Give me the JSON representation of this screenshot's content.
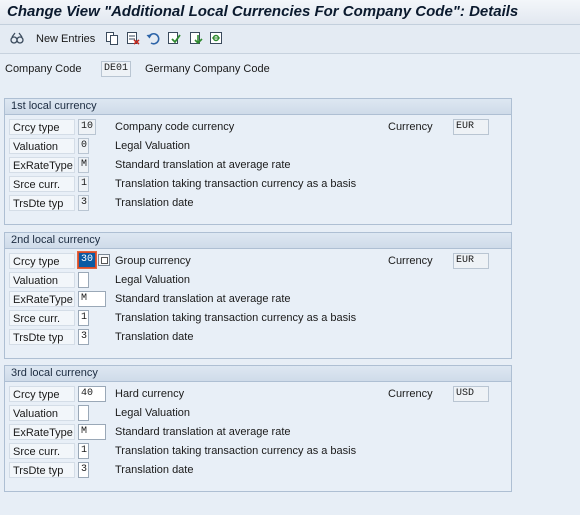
{
  "title": "Change View \"Additional Local Currencies For Company Code\": Details",
  "toolbar": {
    "new_entries_label": "New Entries",
    "icons": [
      "glasses-icon",
      "copy-icon",
      "delete-icon",
      "undo-icon",
      "select-all-icon",
      "deselect-all-icon",
      "config-icon"
    ]
  },
  "company": {
    "label": "Company Code",
    "code": "DE01",
    "name": "Germany Company Code"
  },
  "sections": [
    {
      "heading": "1st local currency",
      "crcy_type": {
        "label": "Crcy type",
        "value": "10",
        "desc": "Company code currency"
      },
      "currency": {
        "label": "Currency",
        "value": "EUR"
      },
      "valuation": {
        "label": "Valuation",
        "value": "0",
        "desc": "Legal Valuation"
      },
      "exratetype": {
        "label": "ExRateType",
        "value": "M",
        "desc": "Standard translation at average rate"
      },
      "srce_curr": {
        "label": "Srce curr.",
        "value": "1",
        "desc": "Translation taking transaction currency as a basis"
      },
      "trsdte_typ": {
        "label": "TrsDte typ",
        "value": "3",
        "desc": "Translation date"
      }
    },
    {
      "heading": "2nd local currency",
      "crcy_type": {
        "label": "Crcy type",
        "value": "30",
        "desc": "Group currency"
      },
      "currency": {
        "label": "Currency",
        "value": "EUR"
      },
      "valuation": {
        "label": "Valuation",
        "value": "",
        "desc": "Legal Valuation"
      },
      "exratetype": {
        "label": "ExRateType",
        "value": "M",
        "desc": "Standard translation at average rate"
      },
      "srce_curr": {
        "label": "Srce curr.",
        "value": "1",
        "desc": "Translation taking transaction currency as a basis"
      },
      "trsdte_typ": {
        "label": "TrsDte typ",
        "value": "3",
        "desc": "Translation date"
      }
    },
    {
      "heading": "3rd local currency",
      "crcy_type": {
        "label": "Crcy type",
        "value": "40",
        "desc": "Hard currency"
      },
      "currency": {
        "label": "Currency",
        "value": "USD"
      },
      "valuation": {
        "label": "Valuation",
        "value": "",
        "desc": "Legal Valuation"
      },
      "exratetype": {
        "label": "ExRateType",
        "value": "M",
        "desc": "Standard translation at average rate"
      },
      "srce_curr": {
        "label": "Srce curr.",
        "value": "1",
        "desc": "Translation taking transaction currency as a basis"
      },
      "trsdte_typ": {
        "label": "TrsDte typ",
        "value": "3",
        "desc": "Translation date"
      }
    }
  ]
}
